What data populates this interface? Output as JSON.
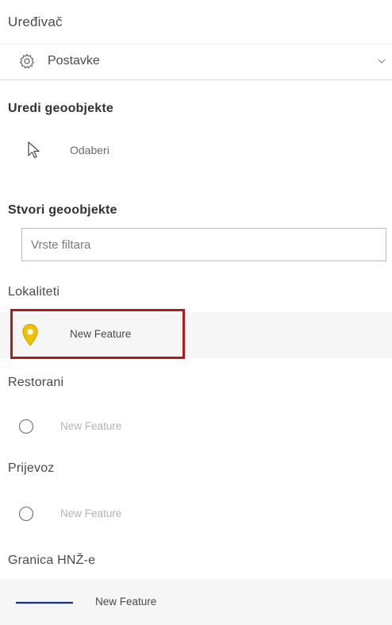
{
  "editor": {
    "title": "Uređivač",
    "settings_label": "Postavke"
  },
  "edit_section": {
    "title": "Uredi geoobjekte",
    "select_label": "Odaberi"
  },
  "create_section": {
    "title": "Stvori geoobjekte",
    "filter_placeholder": "Vrste filtara"
  },
  "layers": [
    {
      "name": "Lokaliteti",
      "template_label": "New Feature",
      "symbol": "yellow-pin-icon",
      "color": "#f2c200",
      "enabled": true,
      "highlighted": true
    },
    {
      "name": "Restorani",
      "template_label": "New Feature",
      "symbol": "circle-icon",
      "enabled": false
    },
    {
      "name": "Prijevoz",
      "template_label": "New Feature",
      "symbol": "circle-icon",
      "enabled": false
    },
    {
      "name": "Granica HNŽ-e",
      "template_label": "New Feature",
      "symbol": "line-icon",
      "color": "#1a2e8c",
      "enabled": true
    }
  ],
  "colors": {
    "highlight": "#b01c1c",
    "band": "#f6f6f6"
  }
}
